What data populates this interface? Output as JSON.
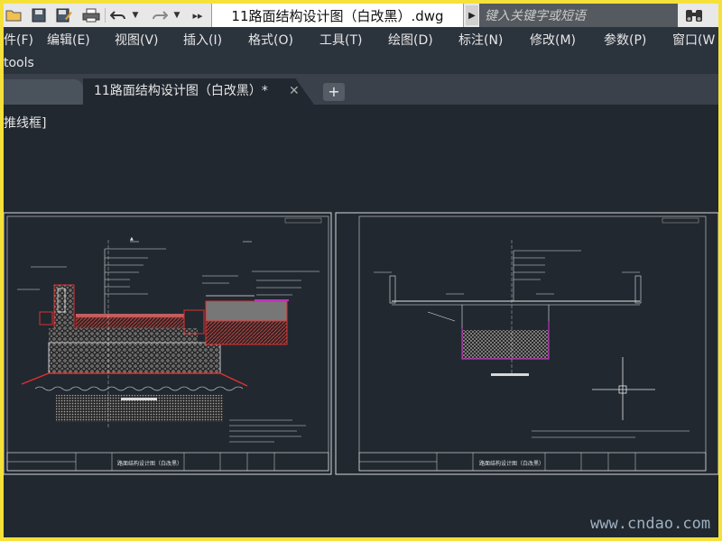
{
  "document": {
    "title": "11路面结构设计图（白改黑）.dwg"
  },
  "search": {
    "placeholder": "键入关键字或短语"
  },
  "menu": [
    {
      "label": "件(F)"
    },
    {
      "label": "编辑(E)"
    },
    {
      "label": "视图(V)"
    },
    {
      "label": "插入(I)"
    },
    {
      "label": "格式(O)"
    },
    {
      "label": "工具(T)"
    },
    {
      "label": "绘图(D)"
    },
    {
      "label": "标注(N)"
    },
    {
      "label": "修改(M)"
    },
    {
      "label": "参数(P)"
    },
    {
      "label": "窗口(W"
    }
  ],
  "toolbar2": {
    "label": "tools"
  },
  "tabs": {
    "active_label": "11路面结构设计图（白改黑）*",
    "close_glyph": "✕",
    "new_glyph": "+"
  },
  "viewport": {
    "label": "推线框]"
  },
  "sheets": [
    {
      "title_block": "路面结构设计图（白改黑）"
    },
    {
      "title_block": "路面结构设计图（白改黑）"
    }
  ],
  "watermark": "www.cndao.com",
  "colors": {
    "frame_border": "#f5e13a",
    "canvas_bg": "#212830",
    "menu_bg": "#2b333d",
    "cad_red": "#e03030",
    "cad_magenta": "#c030c0",
    "cad_white": "#e8e8e8"
  },
  "icons": [
    "open-icon",
    "save-icon",
    "save-as-icon",
    "print-icon",
    "undo-icon",
    "redo-icon",
    "more-icon",
    "play-icon",
    "binoculars-icon",
    "plus-icon",
    "close-icon"
  ]
}
